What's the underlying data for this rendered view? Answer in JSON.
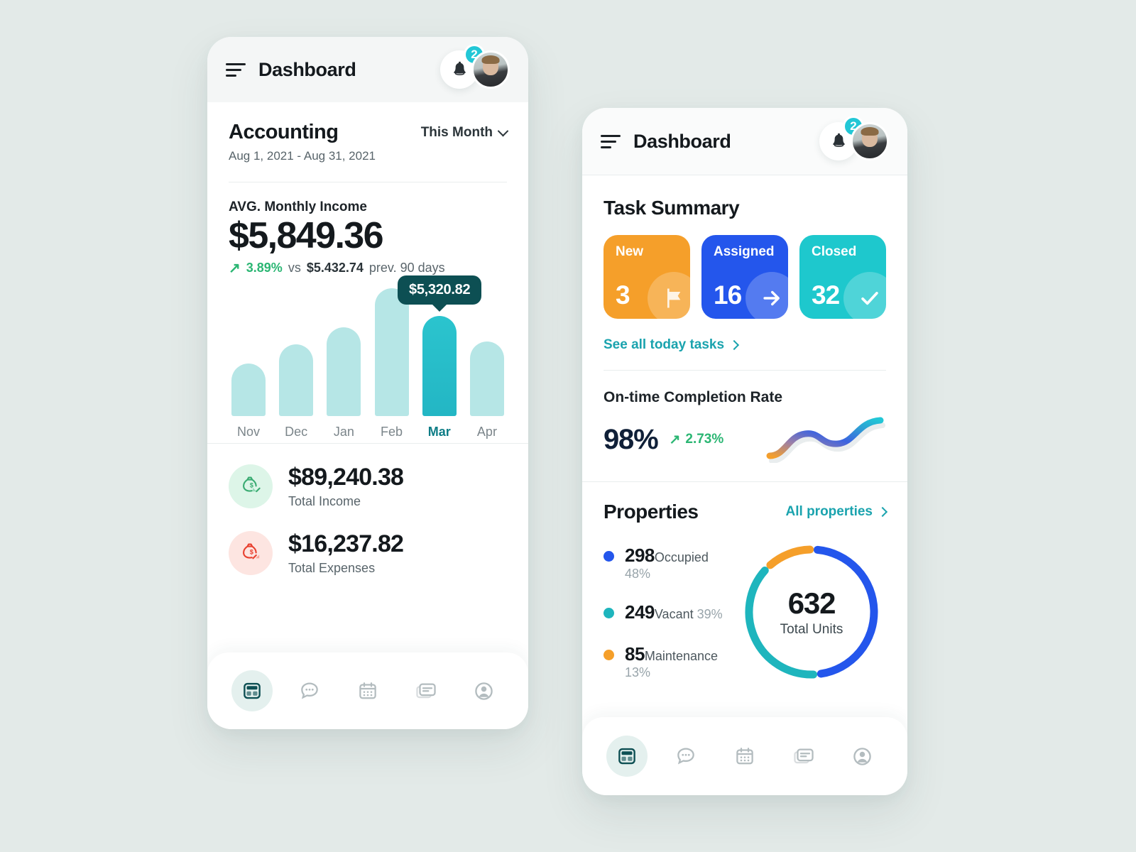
{
  "colors": {
    "background": "#e3eae8",
    "accent_teal": "#22c7d6",
    "dark_teal": "#0d4f53",
    "green": "#2bb673",
    "red": "#e8402f",
    "orange": "#f59f2a",
    "blue": "#2456ec",
    "teal": "#1ec8cd"
  },
  "left_phone": {
    "topbar": {
      "title": "Dashboard",
      "notification_count": "2"
    },
    "accounting": {
      "title": "Accounting",
      "date_range": "Aug 1, 2021 - Aug 31, 2021",
      "period_selector": "This Month",
      "income_label": "AVG. Monthly Income",
      "income_amount": "$5,849.36",
      "delta_arrow": "↗",
      "delta_percent": "3.89%",
      "delta_vs": "vs",
      "delta_prev_amount": "$5.432.74",
      "delta_prev_suffix": "prev. 90 days",
      "tooltip_value": "$5,320.82"
    },
    "totals": [
      {
        "amount": "$89,240.38",
        "label": "Total Income",
        "icon": "money-bag-in-icon"
      },
      {
        "amount": "$16,237.82",
        "label": "Total Expenses",
        "icon": "money-bag-out-icon"
      }
    ],
    "nav": [
      {
        "icon": "dashboard-icon",
        "active": true
      },
      {
        "icon": "chat-icon",
        "active": false
      },
      {
        "icon": "calendar-icon",
        "active": false
      },
      {
        "icon": "messages-icon",
        "active": false
      },
      {
        "icon": "profile-icon",
        "active": false
      }
    ]
  },
  "right_phone": {
    "topbar": {
      "title": "Dashboard",
      "notification_count": "2"
    },
    "task_summary": {
      "title": "Task Summary",
      "cards": [
        {
          "label": "New",
          "value": "3",
          "icon": "flag-icon",
          "color": "#f59f2a"
        },
        {
          "label": "Assigned",
          "value": "16",
          "icon": "arrow-right-icon",
          "color": "#2456ec"
        },
        {
          "label": "Closed",
          "value": "32",
          "icon": "check-icon",
          "color": "#1ec8cd"
        }
      ],
      "see_all_link": "See all today tasks"
    },
    "completion": {
      "title": "On-time Completion Rate",
      "value": "98%",
      "delta_arrow": "↗",
      "delta": "2.73%"
    },
    "properties": {
      "title": "Properties",
      "all_link": "All properties",
      "total": "632",
      "total_label": "Total Units",
      "items": [
        {
          "count": "298",
          "label": "Occupied",
          "percent": "48%",
          "color": "#2456ec"
        },
        {
          "count": "249",
          "label": "Vacant",
          "percent": "39%",
          "color": "#1eb5bd"
        },
        {
          "count": "85",
          "label": "Maintenance",
          "percent": "13%",
          "color": "#f59f2a"
        }
      ]
    },
    "nav": [
      {
        "icon": "dashboard-icon",
        "active": true
      },
      {
        "icon": "chat-icon",
        "active": false
      },
      {
        "icon": "calendar-icon",
        "active": false
      },
      {
        "icon": "messages-icon",
        "active": false
      },
      {
        "icon": "profile-icon",
        "active": false
      }
    ]
  },
  "chart_data": [
    {
      "type": "bar",
      "title": "AVG. Monthly Income",
      "categories": [
        "Nov",
        "Dec",
        "Jan",
        "Feb",
        "Mar",
        "Apr"
      ],
      "values": [
        62,
        84,
        104,
        150,
        118,
        88
      ],
      "highlight_index": 4,
      "highlight_value": "$5,320.82",
      "ylabel": "",
      "xlabel": "",
      "grid": false
    },
    {
      "type": "line",
      "title": "On-time Completion Rate",
      "x": [
        0,
        1,
        2,
        3,
        4,
        5
      ],
      "values": [
        6,
        22,
        44,
        30,
        52,
        72
      ],
      "grid": false,
      "legend": "none"
    },
    {
      "type": "pie",
      "title": "Properties",
      "categories": [
        "Occupied",
        "Vacant",
        "Maintenance"
      ],
      "values": [
        298,
        249,
        85
      ],
      "percents": [
        48,
        39,
        13
      ],
      "colors": [
        "#2456ec",
        "#1eb5bd",
        "#f59f2a"
      ],
      "center_value": "632",
      "center_label": "Total Units"
    }
  ]
}
